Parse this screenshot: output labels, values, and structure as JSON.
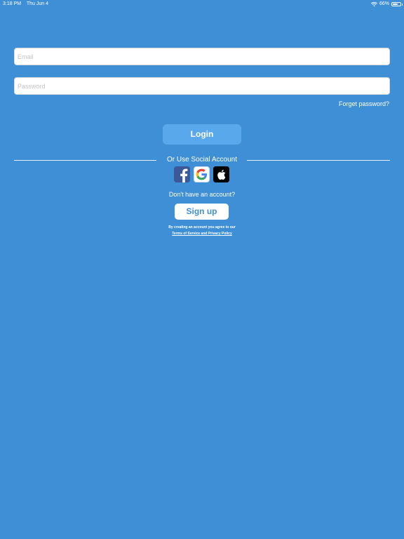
{
  "status_bar": {
    "time": "3:18 PM",
    "date": "Thu Jun 4",
    "battery": "66%",
    "battery_level": 0.66
  },
  "form": {
    "email_placeholder": "Email",
    "password_placeholder": "Password",
    "forget_password": "Forget password?",
    "login_label": "Login"
  },
  "social": {
    "divider_text": "Or Use Social Account",
    "buttons": [
      {
        "name": "facebook",
        "icon": "facebook-icon"
      },
      {
        "name": "google",
        "icon": "google-icon"
      },
      {
        "name": "apple",
        "icon": "apple-icon"
      }
    ]
  },
  "signup": {
    "prompt": "Don't have an account?",
    "button_label": "Sign up",
    "agree_text": "By creating an account you agree to our",
    "terms_link": "Terms of Service and Privacy Policy"
  },
  "colors": {
    "background": "#3f8fd6",
    "login_button": "#5aa8ec",
    "facebook": "#3b5998"
  }
}
